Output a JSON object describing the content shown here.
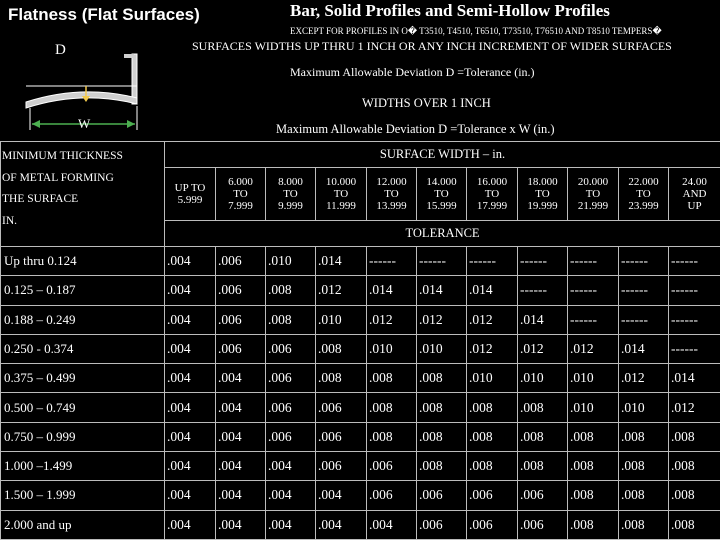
{
  "header": {
    "title_left": "Flatness (Flat Surfaces)",
    "title_right": "Bar, Solid Profiles and Semi-Hollow Profiles",
    "except_note": "EXCEPT FOR PROFILES IN O� T3510, T4510, T6510, T73510, T76510 AND T8510 TEMPERS�",
    "line1": "SURFACES WIDTHS UP THRU 1 INCH OR ANY INCH INCREMENT OF WIDER SURFACES",
    "line2": "Maximum Allowable Deviation D =Tolerance (in.)",
    "line3": "WIDTHS OVER 1 INCH",
    "line4": "Maximum Allowable Deviation D =Tolerance x W (in.)"
  },
  "diagram": {
    "d_label": "D",
    "w_label": "W"
  },
  "table": {
    "left_header": [
      "MINIMUM THICKNESS",
      "OF METAL FORMING",
      "THE SURFACE",
      "IN."
    ],
    "surface_width_label": "SURFACE WIDTH – in.",
    "tolerance_label": "TOLERANCE",
    "columns": [
      [
        "UP TO",
        "5.999"
      ],
      [
        "6.000",
        "TO",
        "7.999"
      ],
      [
        "8.000",
        "TO",
        "9.999"
      ],
      [
        "10.000",
        "TO",
        "11.999"
      ],
      [
        "12.000",
        "TO",
        "13.999"
      ],
      [
        "14.000",
        "TO",
        "15.999"
      ],
      [
        "16.000",
        "TO",
        "17.999"
      ],
      [
        "18.000",
        "TO",
        "19.999"
      ],
      [
        "20.000",
        "TO",
        "21.999"
      ],
      [
        "22.000",
        "TO",
        "23.999"
      ],
      [
        "24.00",
        "AND",
        "UP"
      ]
    ],
    "rows": [
      {
        "label": "Up thru 0.124",
        "values": [
          ".004",
          ".006",
          ".010",
          ".014",
          "------",
          "------",
          "------",
          "------",
          "------",
          "------",
          "------"
        ]
      },
      {
        "label": "0.125 – 0.187",
        "values": [
          ".004",
          ".006",
          ".008",
          ".012",
          ".014",
          ".014",
          ".014",
          "------",
          "------",
          "------",
          "------"
        ]
      },
      {
        "label": "0.188 – 0.249",
        "values": [
          ".004",
          ".006",
          ".008",
          ".010",
          ".012",
          ".012",
          ".012",
          ".014",
          "------",
          "------",
          "------"
        ]
      },
      {
        "label": "0.250 - 0.374",
        "values": [
          ".004",
          ".006",
          ".006",
          ".008",
          ".010",
          ".010",
          ".012",
          ".012",
          ".012",
          ".014",
          "------"
        ]
      },
      {
        "label": "0.375 – 0.499",
        "values": [
          ".004",
          ".004",
          ".006",
          ".008",
          ".008",
          ".008",
          ".010",
          ".010",
          ".010",
          ".012",
          ".014"
        ]
      },
      {
        "label": "0.500 – 0.749",
        "values": [
          ".004",
          ".004",
          ".006",
          ".006",
          ".008",
          ".008",
          ".008",
          ".008",
          ".010",
          ".010",
          ".012"
        ]
      },
      {
        "label": "0.750 – 0.999",
        "values": [
          ".004",
          ".004",
          ".006",
          ".006",
          ".008",
          ".008",
          ".008",
          ".008",
          ".008",
          ".008",
          ".008"
        ]
      },
      {
        "label": "1.000 –1.499",
        "values": [
          ".004",
          ".004",
          ".004",
          ".006",
          ".006",
          ".008",
          ".008",
          ".008",
          ".008",
          ".008",
          ".008"
        ]
      },
      {
        "label": "1.500 – 1.999",
        "values": [
          ".004",
          ".004",
          ".004",
          ".004",
          ".006",
          ".006",
          ".006",
          ".006",
          ".008",
          ".008",
          ".008"
        ]
      },
      {
        "label": "2.000 and up",
        "values": [
          ".004",
          ".004",
          ".004",
          ".004",
          ".004",
          ".006",
          ".006",
          ".006",
          ".008",
          ".008",
          ".008"
        ]
      }
    ]
  }
}
